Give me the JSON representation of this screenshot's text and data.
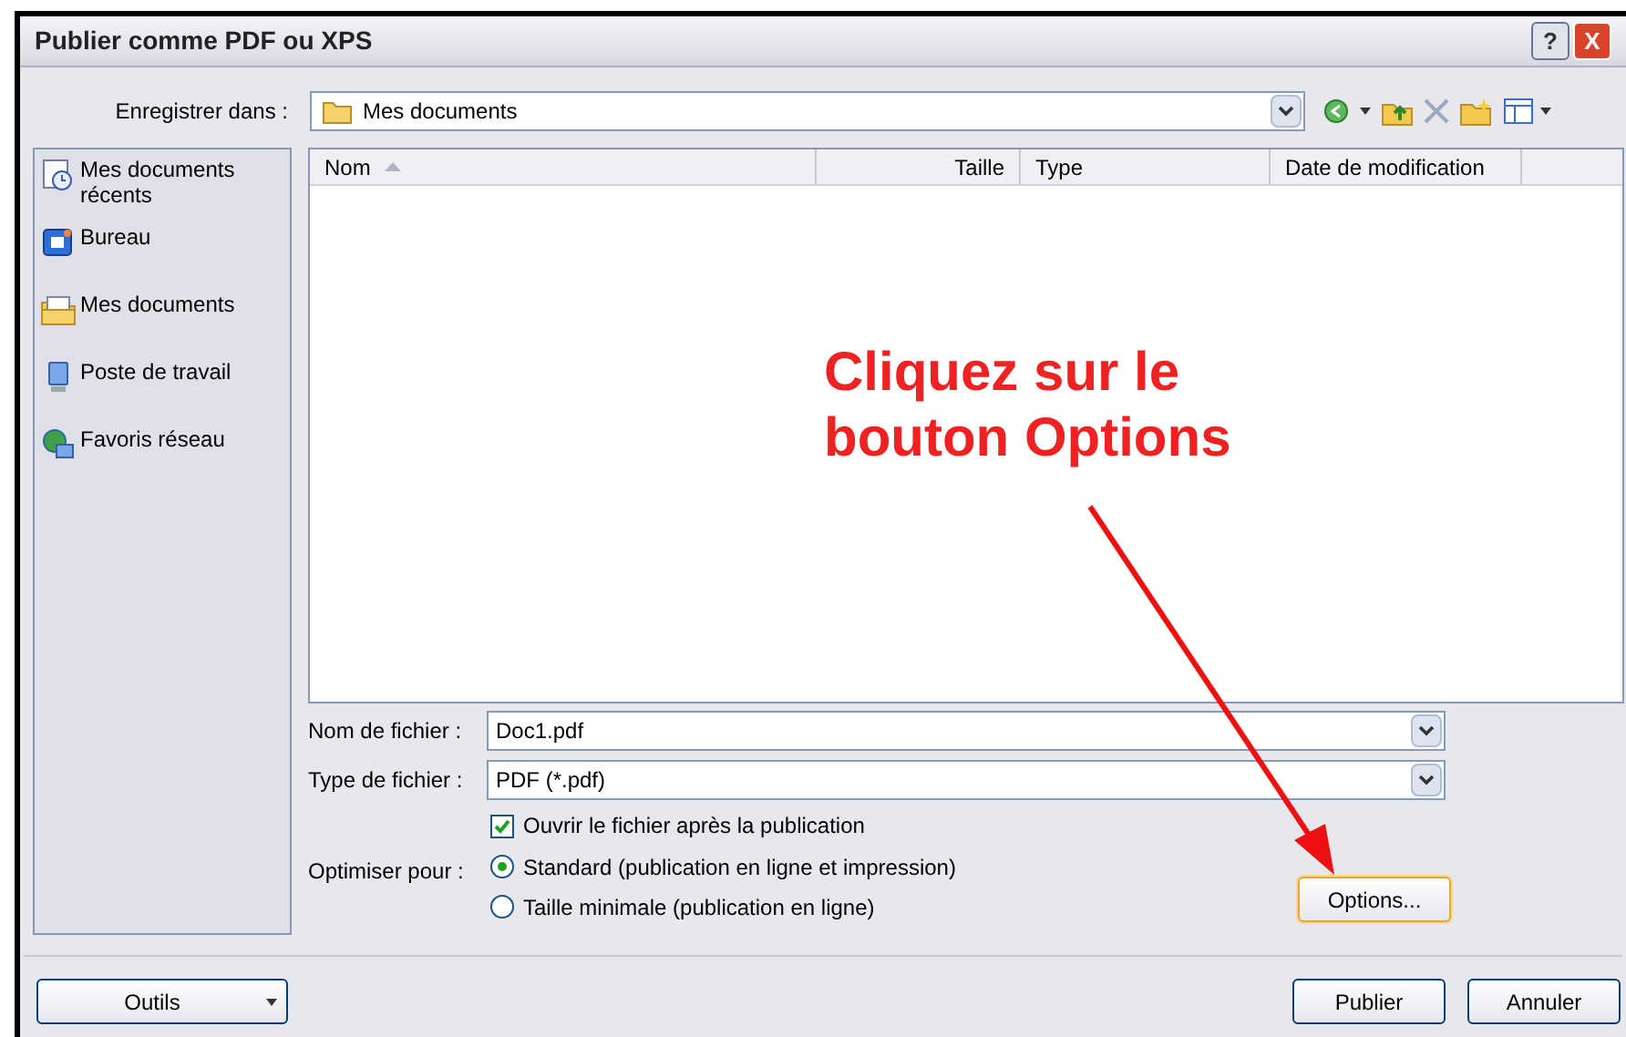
{
  "window": {
    "title": "Publier comme PDF ou XPS",
    "buttons": [
      "?",
      "X"
    ]
  },
  "save_in": {
    "label": "Enregistrer dans :",
    "value": "Mes documents"
  },
  "places": [
    {
      "label": "Mes documents récents",
      "kind": "recent"
    },
    {
      "label": "Bureau",
      "kind": "desktop"
    },
    {
      "label": "Mes documents",
      "kind": "documents"
    },
    {
      "label": "Poste de travail",
      "kind": "computer"
    },
    {
      "label": "Favoris réseau",
      "kind": "network"
    }
  ],
  "file_list": {
    "columns": [
      {
        "label": "Nom",
        "sorted": true
      },
      {
        "label": "Taille",
        "sorted": false
      },
      {
        "label": "Type",
        "sorted": false
      },
      {
        "label": "Date de modification",
        "sorted": false
      }
    ]
  },
  "file_name": {
    "label": "Nom de fichier :",
    "value": "Doc1.pdf"
  },
  "file_type": {
    "label": "Type de fichier :",
    "value": "PDF (*.pdf)"
  },
  "open_after": {
    "label": "Ouvrir le fichier après la publication",
    "checked": true
  },
  "optimize": {
    "label": "Optimiser pour :",
    "options": [
      {
        "label": "Standard (publication en ligne et impression)",
        "selected": true
      },
      {
        "label": "Taille minimale (publication en ligne)",
        "selected": false
      }
    ]
  },
  "options_button": "Options...",
  "tools_button": "Outils",
  "publish_button": "Publier",
  "cancel_button": "Annuler",
  "annotation": {
    "lines": [
      "Cliquez sur le",
      "bouton Options"
    ]
  }
}
